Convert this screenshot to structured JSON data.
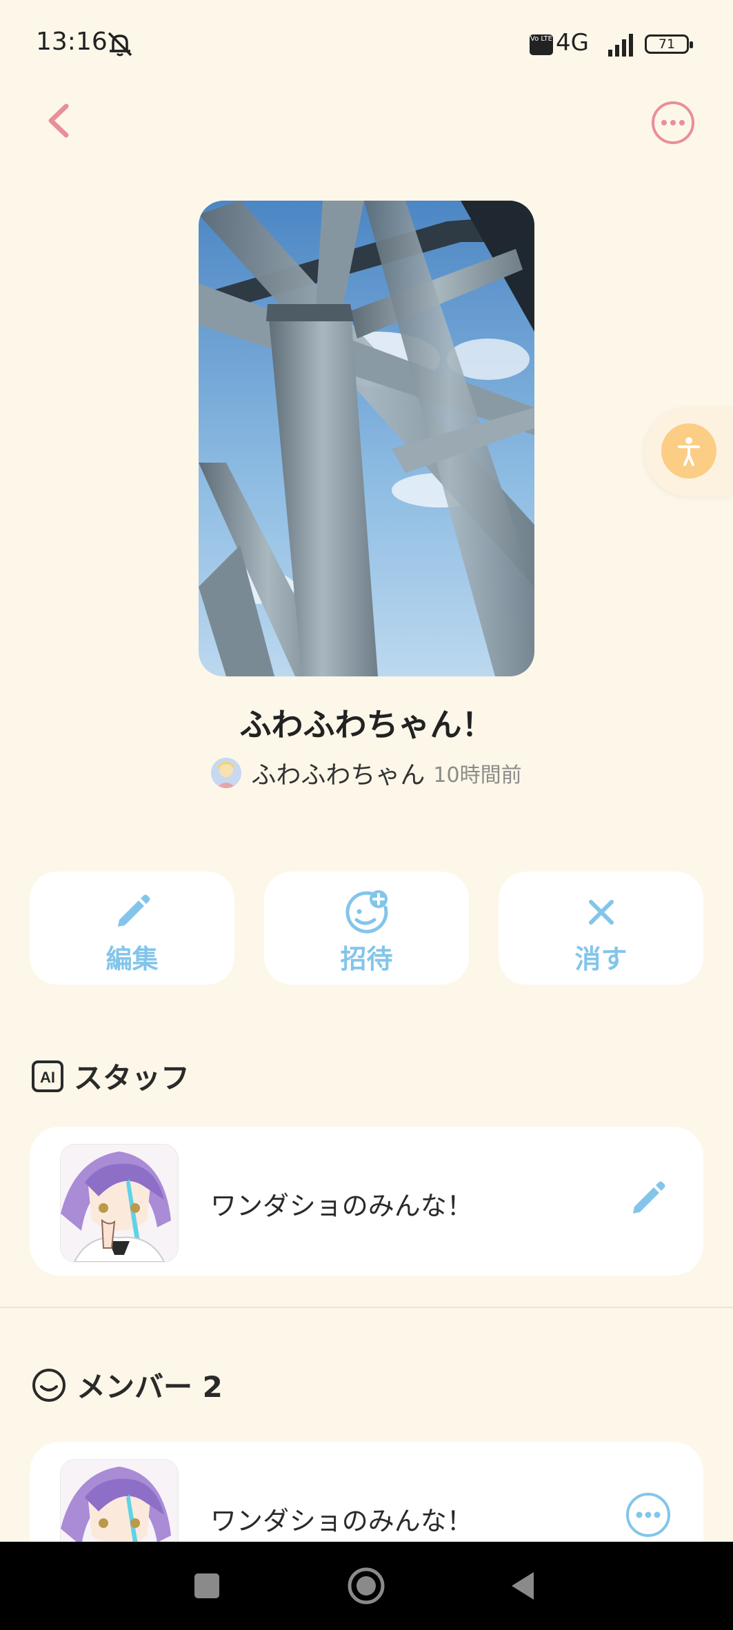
{
  "status_bar": {
    "time": "13:16",
    "volte": "Vo LTE",
    "network": "4G",
    "battery": "71",
    "icons": [
      "bell-muted-icon",
      "signal-icon",
      "battery-icon"
    ]
  },
  "nav": {
    "back_icon": "chevron-left-icon",
    "more_icon": "more-horizontal-icon"
  },
  "room": {
    "title": "ふわふわちゃん！",
    "author": "ふわふわちゃん",
    "time_ago": "10時間前"
  },
  "actions": [
    {
      "label": "編集",
      "icon": "pencil-icon"
    },
    {
      "label": "招待",
      "icon": "add-person-icon"
    },
    {
      "label": "消す",
      "icon": "close-icon"
    }
  ],
  "staff_section": {
    "title": "スタッフ",
    "icon": "ai-icon",
    "items": [
      {
        "name": "ワンダショのみんな！",
        "action_icon": "pencil-icon"
      }
    ]
  },
  "member_section": {
    "title": "メンバー 2",
    "icon": "smile-icon",
    "items": [
      {
        "name": "ワンダショのみんな！",
        "action_icon": "more-horizontal-icon"
      }
    ]
  },
  "colors": {
    "background": "#fdf7e9",
    "accent_pink": "#e88f98",
    "accent_blue": "#83c5ea",
    "accent_orange": "#fbcd85"
  },
  "system_nav": [
    "recent-apps-icon",
    "home-icon",
    "back-triangle-icon"
  ]
}
